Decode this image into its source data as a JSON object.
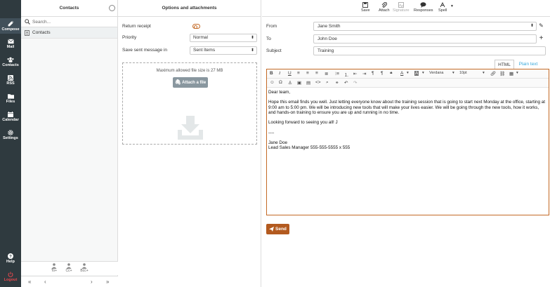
{
  "nav": {
    "items": [
      {
        "label": "Compose",
        "icon": "compose-icon"
      },
      {
        "label": "Mail",
        "icon": "mail-icon"
      },
      {
        "label": "Contacts",
        "icon": "contacts-icon"
      },
      {
        "label": "RSS",
        "icon": "rss-icon"
      },
      {
        "label": "Files",
        "icon": "folder-icon"
      },
      {
        "label": "Calendar",
        "icon": "calendar-icon"
      },
      {
        "label": "Settings",
        "icon": "gear-icon"
      }
    ],
    "help": "Help",
    "logout": "Logout"
  },
  "contacts": {
    "title": "Contacts",
    "search_placeholder": "Search...",
    "list": [
      "Contacts"
    ],
    "recipients": {
      "to": "To+",
      "cc": "Cc+",
      "bcc": "Bcc+"
    },
    "pager": {
      "first": "«",
      "prev": "‹",
      "next": "›",
      "last": "»"
    }
  },
  "options": {
    "title": "Options and attachments",
    "return_receipt": "Return receipt",
    "priority_label": "Priority",
    "priority_value": "Normal",
    "sent_label": "Save sent message in",
    "sent_value": "Sent Items",
    "max_size": "Maximum allowed file size is 27 MB",
    "attach_label": "Attach a file"
  },
  "toolbar": {
    "save": "Save",
    "attach": "Attach",
    "signature": "Signature",
    "responses": "Responses",
    "spell": "Spell"
  },
  "fields": {
    "from_label": "From",
    "from_value": "Jane Smith",
    "to_label": "To",
    "to_value": "John Doe",
    "subject_label": "Subject",
    "subject_value": "Training"
  },
  "editor": {
    "tab_html": "HTML",
    "tab_plain": "Plain text",
    "font": "Verdana",
    "size": "10pt",
    "greeting": "Dear team,",
    "paragraph": "Hope this email finds you well. Just letting everyone know about the training session that is going to start next Monday at the office, starting at 9:00 am to 5:00 pm. We will be introducing new tools that will make your lives easier. We will be going through the new tools, how it works, and hands-on training to ensure you are up and running in no time.",
    "closing": "Looking forward to seeing you all!  J",
    "separator": "----",
    "sig_name": "Jane Doe",
    "sig_title": "Lead Sales Manager 555-555-5555 x 555"
  },
  "send_label": "Send",
  "colors": {
    "accent": "#c46a26",
    "nav_bg": "#2f3a3f",
    "link": "#37a8db"
  }
}
